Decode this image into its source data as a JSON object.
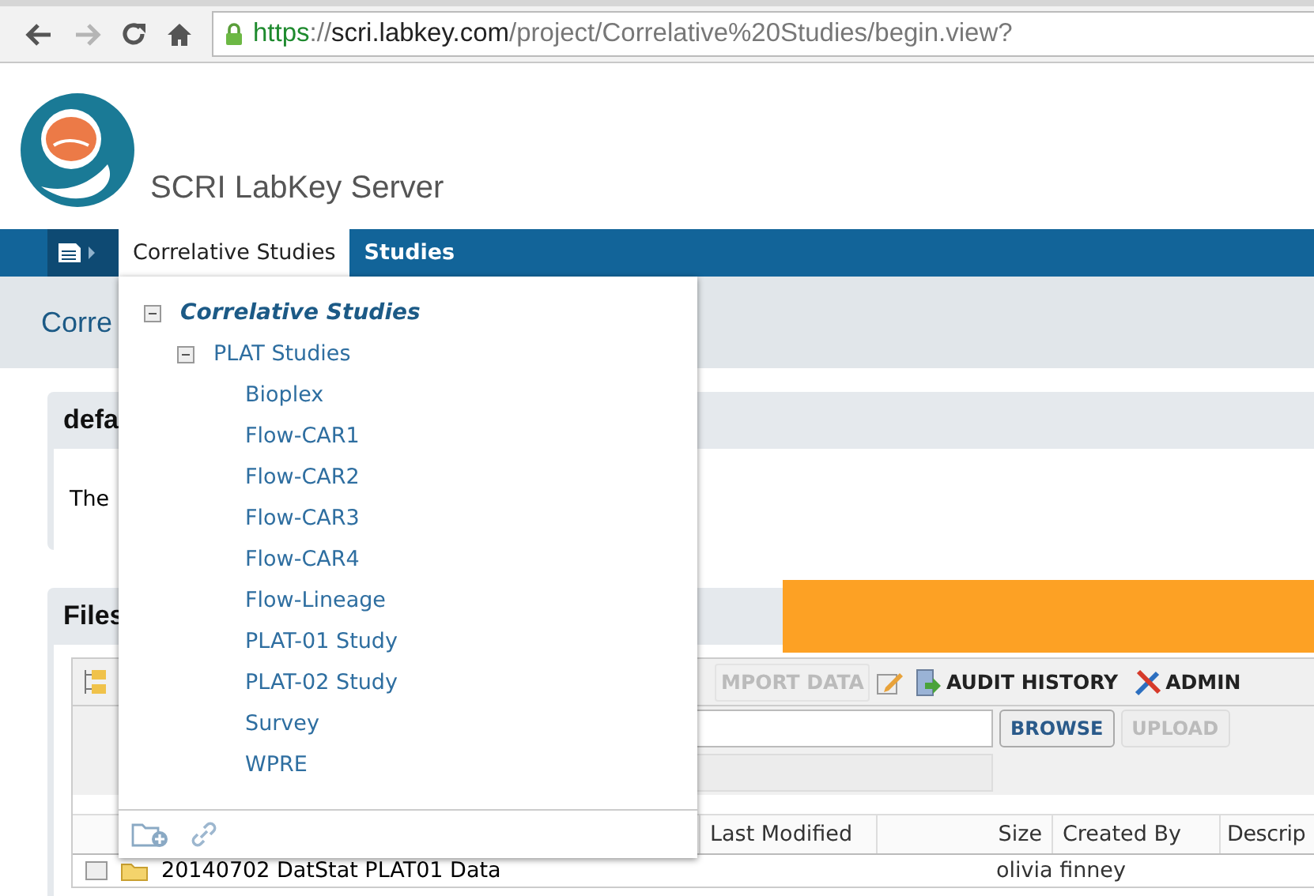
{
  "browser": {
    "buttons": [
      {
        "kind": "back",
        "disabled": false
      },
      {
        "kind": "forward",
        "disabled": true
      },
      {
        "kind": "reload",
        "disabled": false
      },
      {
        "kind": "home",
        "disabled": false
      }
    ],
    "url": {
      "scheme": "https",
      "separator": "://",
      "host": "scri.labkey.com",
      "path": "/project/Correlative%20Studies/begin.view?"
    }
  },
  "site_title": "SCRI LabKey Server",
  "nav": {
    "tabs": [
      {
        "label": "Correlative Studies",
        "selected": true
      },
      {
        "label": "Studies",
        "selected": false
      }
    ]
  },
  "page_title": "Corre",
  "panel": {
    "title": "defa",
    "text": "The"
  },
  "files": {
    "title": "Files",
    "toolbar": [
      {
        "kind": "import",
        "label": "MPORT DATA",
        "disabled": true
      },
      {
        "kind": "edit",
        "disabled": false
      },
      {
        "kind": "audit",
        "label": "AUDIT HISTORY",
        "disabled": false
      },
      {
        "kind": "admin",
        "label": "ADMIN",
        "disabled": false
      }
    ],
    "browse": "BROWSE",
    "upload": {
      "label": "UPLOAD",
      "disabled": true
    },
    "columns": [
      "Last Modified",
      "Size",
      "Created By",
      "Descrip"
    ],
    "rows": [
      {
        "name": "20140702 DatStat PLAT01 Data",
        "created_by": "olivia finney"
      }
    ]
  },
  "menu": {
    "tree": [
      {
        "label": "Correlative Studies",
        "current": true,
        "expanded": true,
        "children": [
          {
            "label": "PLAT Studies",
            "current": false,
            "expanded": true,
            "children": [
              {
                "label": "Bioplex",
                "current": false
              },
              {
                "label": "Flow-CAR1",
                "current": false
              },
              {
                "label": "Flow-CAR2",
                "current": false
              },
              {
                "label": "Flow-CAR3",
                "current": false
              },
              {
                "label": "Flow-CAR4",
                "current": false
              },
              {
                "label": "Flow-Lineage",
                "current": false
              },
              {
                "label": "PLAT-01 Study",
                "current": false
              },
              {
                "label": "PLAT-02 Study",
                "current": false
              },
              {
                "label": "Survey",
                "current": false
              },
              {
                "label": "WPRE",
                "current": false
              }
            ]
          }
        ]
      }
    ]
  }
}
